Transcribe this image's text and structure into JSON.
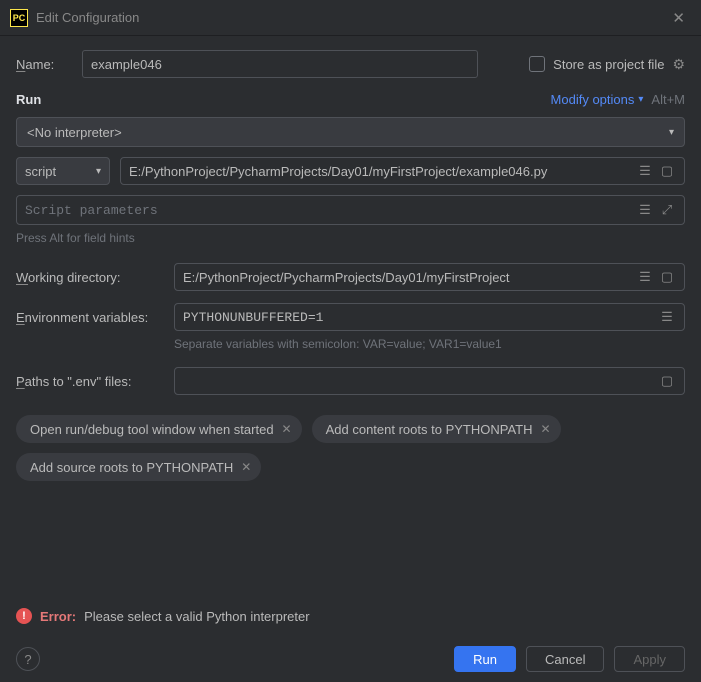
{
  "titlebar": {
    "title": "Edit Configuration"
  },
  "name": {
    "label": "Name:",
    "value": "example046"
  },
  "store": {
    "label": "Store as project file"
  },
  "section": {
    "title": "Run",
    "modify": "Modify options",
    "shortcut": "Alt+M"
  },
  "interpreter": {
    "value": "<No interpreter>"
  },
  "script": {
    "type_label": "script",
    "path": "E:/PythonProject/PycharmProjects/Day01/myFirstProject/example046.py"
  },
  "params": {
    "placeholder": "Script parameters"
  },
  "hint": "Press Alt for field hints",
  "workdir": {
    "label": "Working directory:",
    "value": "E:/PythonProject/PycharmProjects/Day01/myFirstProject"
  },
  "envvars": {
    "label": "Environment variables:",
    "value": "PYTHONUNBUFFERED=1",
    "hint": "Separate variables with semicolon: VAR=value; VAR1=value1"
  },
  "envfiles": {
    "label": "Paths to \".env\" files:",
    "value": ""
  },
  "chips": [
    "Open run/debug tool window when started",
    "Add content roots to PYTHONPATH",
    "Add source roots to PYTHONPATH"
  ],
  "error": {
    "label": "Error:",
    "msg": "Please select a valid Python interpreter"
  },
  "buttons": {
    "run": "Run",
    "cancel": "Cancel",
    "apply": "Apply"
  }
}
